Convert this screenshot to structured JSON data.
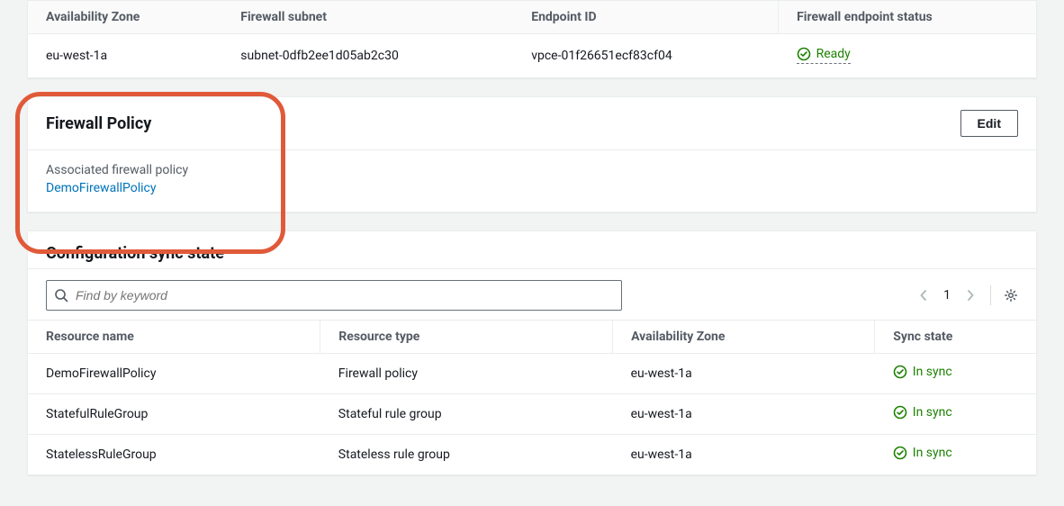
{
  "subnet_table": {
    "headers": {
      "az": "Availability Zone",
      "subnet": "Firewall subnet",
      "endpoint": "Endpoint ID",
      "status": "Firewall endpoint status"
    },
    "row": {
      "az": "eu-west-1a",
      "subnet": "subnet-0dfb2ee1d05ab2c30",
      "endpoint": "vpce-01f26651ecf83cf04",
      "status": "Ready"
    }
  },
  "policy_panel": {
    "title": "Firewall Policy",
    "edit_label": "Edit",
    "associated_label": "Associated firewall policy",
    "policy_link": "DemoFirewallPolicy"
  },
  "sync_panel": {
    "title": "Configuration sync state",
    "search_placeholder": "Find by keyword",
    "page_number": "1",
    "headers": {
      "name": "Resource name",
      "type": "Resource type",
      "az": "Availability Zone",
      "state": "Sync state"
    },
    "rows": [
      {
        "name": "DemoFirewallPolicy",
        "type": "Firewall policy",
        "az": "eu-west-1a",
        "state": "In sync"
      },
      {
        "name": "StatefulRuleGroup",
        "type": "Stateful rule group",
        "az": "eu-west-1a",
        "state": "In sync"
      },
      {
        "name": "StatelessRuleGroup",
        "type": "Stateless rule group",
        "az": "eu-west-1a",
        "state": "In sync"
      }
    ]
  },
  "colors": {
    "success": "#1d8102",
    "link": "#0073bb",
    "highlight": "#e05a3a"
  }
}
